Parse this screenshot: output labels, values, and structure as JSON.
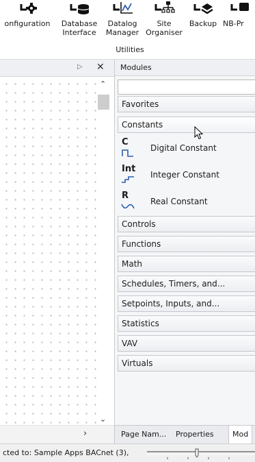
{
  "ribbon": {
    "buttons": [
      {
        "label": "onfiguration",
        "icon": "configuration-icon"
      },
      {
        "label": "Database\nInterface",
        "icon": "database-icon"
      },
      {
        "label": "Datalog\nManager",
        "icon": "datalog-chart-icon"
      },
      {
        "label": "Site\nOrganiser",
        "icon": "site-organiser-icon"
      },
      {
        "label": "Backup",
        "icon": "backup-icon"
      },
      {
        "label": "NB-Pr",
        "icon": "nb-pro-icon"
      }
    ],
    "group_label": "Utilities"
  },
  "left_panel": {
    "pin_glyph": "▷",
    "close_glyph": "✕",
    "scroll_up_glyph": "⌃",
    "scroll_down_glyph": "⌄",
    "scroll_right_glyph": "›"
  },
  "modules": {
    "title": "Modules",
    "search_value": "",
    "categories_top": [
      {
        "label": "Favorites",
        "expanded": false
      },
      {
        "label": "Constants",
        "expanded": true
      }
    ],
    "constant_items": [
      {
        "abbr": "C",
        "label": "Digital Constant",
        "icon": "digital-wave-icon"
      },
      {
        "abbr": "Int",
        "label": "Integer Constant",
        "icon": "integer-step-icon"
      },
      {
        "abbr": "R",
        "label": "Real Constant",
        "icon": "real-sine-icon"
      }
    ],
    "categories_bottom": [
      "Controls",
      "Functions",
      "Math",
      "Schedules, Timers, and...",
      "Setpoints, Inputs, and...",
      "Statistics",
      "VAV",
      "Virtuals"
    ],
    "bottom_tabs": [
      "Page Nam...",
      "Properties",
      "Mod"
    ]
  },
  "status_bar": {
    "text": "cted to: Sample Apps BACnet (3),"
  },
  "colors": {
    "icon_dark": "#111111",
    "icon_blue": "#2a5db0",
    "panel_header": "#eef0f3"
  }
}
